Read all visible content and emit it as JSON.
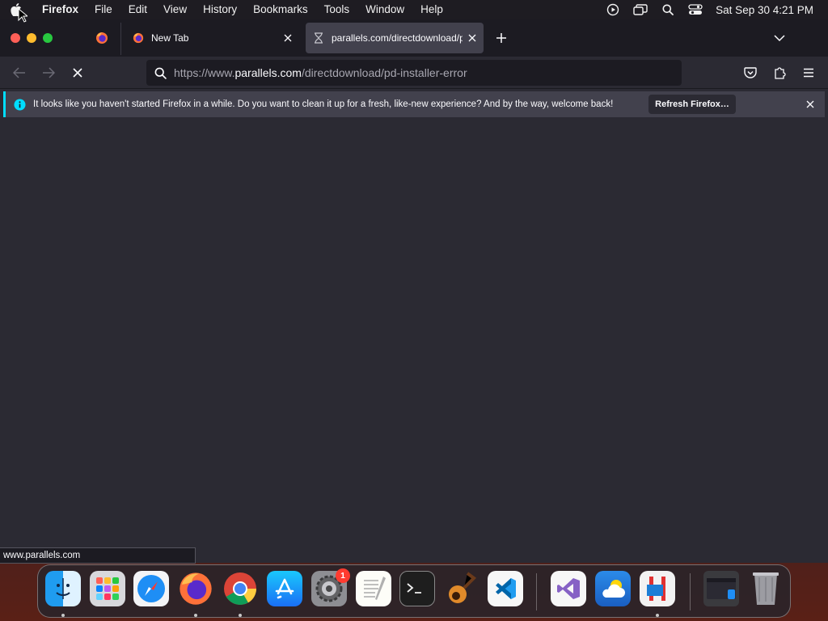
{
  "menubar": {
    "app_name": "Firefox",
    "menus": [
      "File",
      "Edit",
      "View",
      "History",
      "Bookmarks",
      "Tools",
      "Window",
      "Help"
    ],
    "clock": "Sat Sep 30  4:21 PM"
  },
  "tabs": [
    {
      "title": "New Tab",
      "icon": "firefox-icon"
    },
    {
      "title": "parallels.com/directdownload/pd-installer-error",
      "icon": "hourglass-icon",
      "active": true
    }
  ],
  "navbar": {
    "url_prefix": "https://www.",
    "url_host": "parallels.com",
    "url_path": "/directdownload/pd-installer-error"
  },
  "notification": {
    "message": "It looks like you haven't started Firefox in a while. Do you want to clean it up for a fresh, like-new experience? And by the way, welcome back!",
    "button_label": "Refresh Firefox…"
  },
  "status_text": "www.parallels.com",
  "dock": {
    "apps": [
      "Finder",
      "Launchpad",
      "Safari",
      "Firefox",
      "Google Chrome",
      "App Store",
      "System Settings",
      "TextEdit",
      "Terminal",
      "GarageBand",
      "Visual Studio Code",
      "Visual Studio",
      "Weather",
      "Parallels Desktop",
      "Recent Window",
      "Trash"
    ],
    "system_settings_badge": "1"
  },
  "colors": {
    "accent": "#00ddff",
    "toolbar": "#2b2a33",
    "tabstrip": "#1c1b22",
    "active_tab": "#42414d"
  }
}
